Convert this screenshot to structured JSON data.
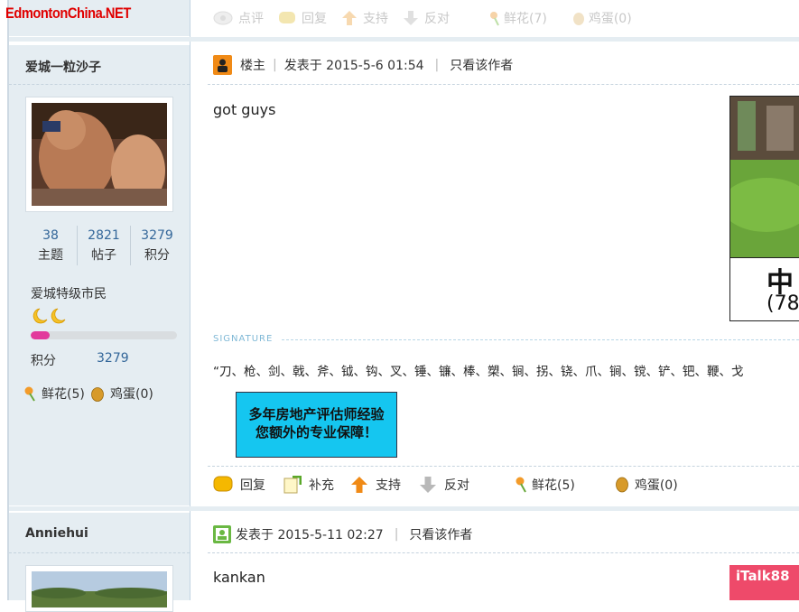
{
  "site": {
    "logo": "EdmontonChina.NET"
  },
  "top_actions": [
    {
      "label": "点评",
      "icon": "comment-icon"
    },
    {
      "label": "回复",
      "icon": "reply-icon"
    },
    {
      "label": "支持",
      "icon": "support-arrow-up-icon"
    },
    {
      "label": "反对",
      "icon": "oppose-arrow-down-icon"
    },
    {
      "label": "鲜花(7)",
      "icon": "flower-icon"
    },
    {
      "label": "鸡蛋(0)",
      "icon": "egg-icon"
    }
  ],
  "post1": {
    "author": "爱城一粒沙子",
    "stats": [
      {
        "num": "38",
        "label": "主题"
      },
      {
        "num": "2821",
        "label": "帖子"
      },
      {
        "num": "3279",
        "label": "积分"
      }
    ],
    "rank": "爱城特级市民",
    "progress_fraction": 0.13,
    "score_label": "积分",
    "score_value": "3279",
    "flower": "鲜花(5)",
    "egg": "鸡蛋(0)",
    "floor": "楼主",
    "posted": "发表于 2015-5-6 01:54",
    "author_only": "只看该作者",
    "content": "got guys",
    "side_image_text": "中",
    "side_image_text2": "(78",
    "signature_label": "SIGNATURE",
    "signature": "“刀、枪、剑、戟、斧、钺、钩、叉、锤、镰、棒、槊、锏、拐、铙、爪、锏、镋、铲、钯、鞭、戈",
    "ad_line1": "多年房地产评估师经验",
    "ad_line2": "您额外的专业保障！",
    "actions": [
      {
        "label": "回复",
        "icon": "reply-icon"
      },
      {
        "label": "补充",
        "icon": "supplement-icon"
      },
      {
        "label": "支持",
        "icon": "support-arrow-up-icon"
      },
      {
        "label": "反对",
        "icon": "oppose-arrow-down-icon"
      },
      {
        "label": "鲜花(5)",
        "icon": "flower-icon"
      },
      {
        "label": "鸡蛋(0)",
        "icon": "egg-icon"
      }
    ]
  },
  "post2": {
    "author": "Anniehui",
    "posted": "发表于 2015-5-11 02:27",
    "author_only": "只看该作者",
    "content": "kankan",
    "side_image_text": "iTalk88"
  },
  "colors": {
    "accent": "#336699",
    "sidebar_bg": "#e5edf2",
    "logo": "#e00000",
    "progress": "#e23a9c",
    "ad_bg": "#15c6f0"
  }
}
